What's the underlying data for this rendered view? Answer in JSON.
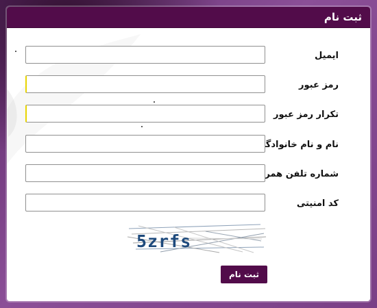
{
  "page": {
    "title": "ثبت نام"
  },
  "fields": [
    {
      "label": "ایمیل",
      "value": ""
    },
    {
      "label": "رمز عبور",
      "value": ""
    },
    {
      "label": "تکرار رمز عبور",
      "value": ""
    },
    {
      "label": "نام و نام خانوادگی",
      "value": ""
    },
    {
      "label": "شماره تلفن همراه",
      "value": ""
    },
    {
      "label": "کد امنیتی",
      "value": ""
    }
  ],
  "captcha": {
    "text": "5zrfs"
  },
  "actions": {
    "submit_label": "ثبت نام"
  },
  "colors": {
    "primary": "#520c4a",
    "background": "#7a3f86",
    "panel": "#ffffff",
    "focus_accent": "#e8d400"
  },
  "icons": {
    "captcha": "captcha-image"
  }
}
